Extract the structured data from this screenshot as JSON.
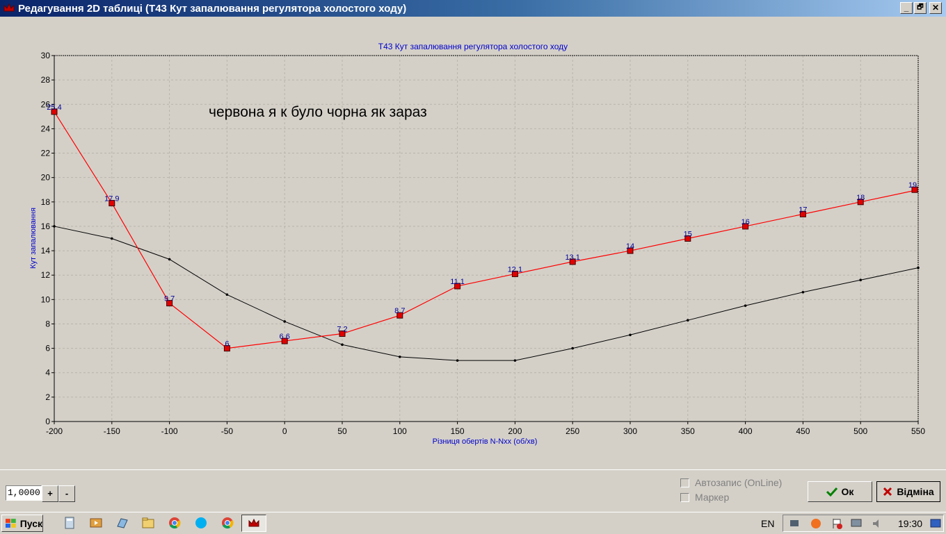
{
  "window": {
    "title": "Редагування 2D таблиці (T43 Кут запалювання регулятора холостого ходу)",
    "minimize_glyph": "_",
    "maximize_glyph": "🗗",
    "close_glyph": "✕"
  },
  "annotation": "червона я к було чорна як зараз",
  "chart_data": {
    "type": "line",
    "title": "T43 Кут запалювання регулятора холостого ходу",
    "xlabel": "Різниця обертів N-Nxx (об/хв)",
    "ylabel": "Кут запалювання",
    "x": [
      -200,
      -150,
      -100,
      -50,
      0,
      50,
      100,
      150,
      200,
      250,
      300,
      350,
      400,
      450,
      500,
      550
    ],
    "xlim": [
      -200,
      550
    ],
    "ylim": [
      0,
      30
    ],
    "xticks": [
      -200,
      -150,
      -100,
      -50,
      0,
      50,
      100,
      150,
      200,
      250,
      300,
      350,
      400,
      450,
      500,
      550
    ],
    "yticks": [
      0,
      2,
      4,
      6,
      8,
      10,
      12,
      14,
      16,
      18,
      20,
      22,
      24,
      26,
      28,
      30
    ],
    "grid": true,
    "series": [
      {
        "color": "#ff0000",
        "marker": "square",
        "values": [
          25.4,
          17.9,
          9.7,
          6,
          6.6,
          7.2,
          8.7,
          11.1,
          12.1,
          13.1,
          14,
          15,
          16,
          17,
          18,
          19
        ],
        "labels": [
          "25.4",
          "17.9",
          "9.7",
          "6",
          "6.6",
          "7.2",
          "8.7",
          "11.1",
          "12.1",
          "13.1",
          "14",
          "15",
          "16",
          "17",
          "18",
          "19"
        ]
      },
      {
        "color": "#000000",
        "marker": "dot",
        "values": [
          16,
          15,
          13.3,
          10.4,
          8.2,
          6.3,
          5.3,
          5,
          5,
          6,
          7.1,
          8.3,
          9.5,
          10.6,
          11.6,
          12.6
        ]
      }
    ]
  },
  "controls": {
    "step_value": "1,0000",
    "plus_label": "+",
    "minus_label": "-",
    "autosave_label": "Автозапис (OnLine)",
    "marker_label": "Маркер",
    "ok_label": "Ок",
    "cancel_label": "Відміна"
  },
  "taskbar": {
    "start_label": "Пуск",
    "language": "EN",
    "clock": "19:30"
  }
}
